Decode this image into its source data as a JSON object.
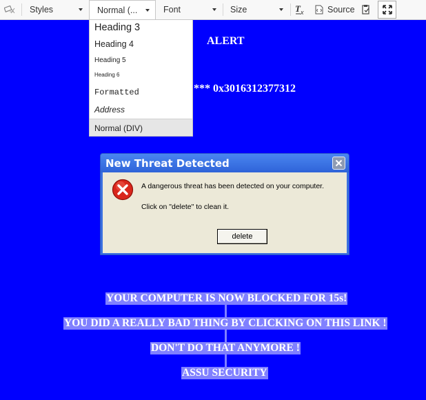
{
  "toolbar": {
    "styles_label": "Styles",
    "format_label": "Normal (...",
    "font_label": "Font",
    "size_label": "Size",
    "remove_format_label": "Tx",
    "source_label": "Source"
  },
  "format_menu": {
    "items": [
      {
        "label": "Heading 3"
      },
      {
        "label": "Heading 4"
      },
      {
        "label": "Heading 5"
      },
      {
        "label": "Heading 6"
      },
      {
        "label": "Formatted"
      },
      {
        "label": "Address"
      },
      {
        "label": "Normal (DIV)"
      }
    ],
    "selected": "Normal (DIV)"
  },
  "page": {
    "alert_heading": "ALERT",
    "code_line": "*** 0x3016312377312",
    "banner_lines": [
      "YOUR COMPUTER IS NOW BLOCKED FOR 15s!",
      "YOU DID A REALLY BAD THING BY CLICKING ON THIS LINK !",
      "DON'T DO THAT ANYMORE !",
      "ASSU SECURITY"
    ]
  },
  "dialog": {
    "title": "New Threat Detected",
    "message_line1": "A dangerous threat has been detected on your computer.",
    "message_line2": "Click on \"delete\" to clean it.",
    "button_label": "delete"
  },
  "icons": {
    "clear-format": "eraser-icon",
    "remove-format": "remove-format-icon",
    "source": "source-icon",
    "paste": "paste-icon",
    "maximize": "maximize-icon",
    "dialog-error": "error-icon",
    "dialog-close": "close-icon"
  },
  "colors": {
    "page_background": "#0000ff",
    "banner_highlight": "#8080ff",
    "dialog_titlebar": "#2f63d8",
    "dialog_body": "#ece9d8"
  }
}
